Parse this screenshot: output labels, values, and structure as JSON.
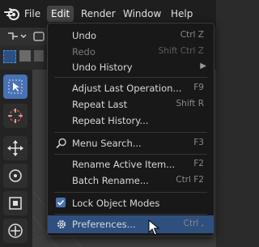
{
  "menubar": {
    "items": [
      {
        "label": "File"
      },
      {
        "label": "Edit"
      },
      {
        "label": "Render"
      },
      {
        "label": "Window"
      },
      {
        "label": "Help"
      }
    ]
  },
  "edit_menu": {
    "items": [
      {
        "label": "Undo",
        "shortcut": "Ctrl Z",
        "underline": "U"
      },
      {
        "label": "Redo",
        "shortcut": "Shift Ctrl Z",
        "disabled": true
      },
      {
        "label": "Undo History",
        "submenu": true
      },
      {
        "label": "Adjust Last Operation...",
        "shortcut": "F9"
      },
      {
        "label": "Repeat Last",
        "shortcut": "Shift R"
      },
      {
        "label": "Repeat History..."
      },
      {
        "label": "Menu Search...",
        "shortcut": "F3",
        "icon": "search-icon"
      },
      {
        "label": "Rename Active Item...",
        "shortcut": "F2"
      },
      {
        "label": "Batch Rename...",
        "shortcut": "Ctrl F2"
      },
      {
        "label": "Lock Object Modes",
        "checked": true
      },
      {
        "label": "Preferences...",
        "shortcut": "Ctrl ,",
        "icon": "gear-icon",
        "highlighted": true
      }
    ]
  },
  "colors": {
    "accent": "#4772b3",
    "menu_bg": "#181818",
    "highlight": "#2f4f7f"
  }
}
